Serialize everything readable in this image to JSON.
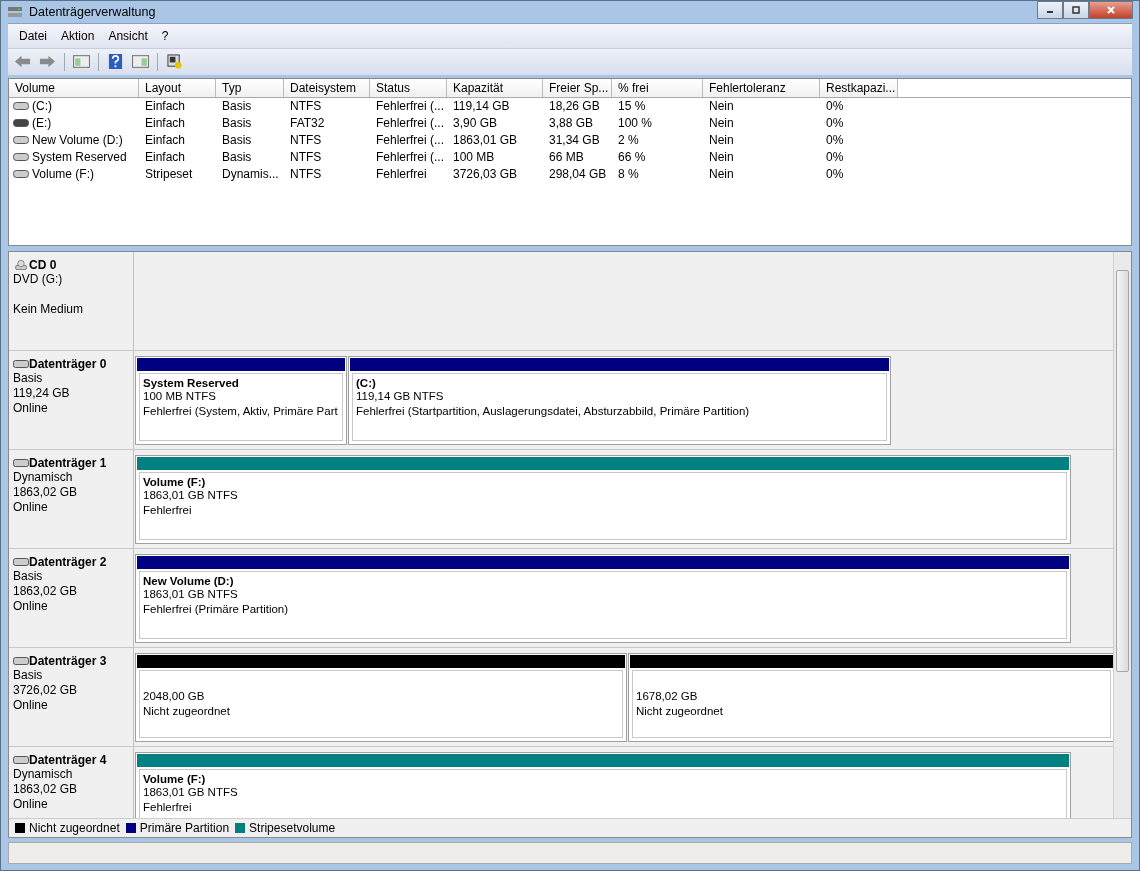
{
  "window": {
    "title": "Datenträgerverwaltung"
  },
  "menu": [
    "Datei",
    "Aktion",
    "Ansicht",
    "?"
  ],
  "table": {
    "columns": [
      "Volume",
      "Layout",
      "Typ",
      "Dateisystem",
      "Status",
      "Kapazität",
      "Freier Sp...",
      "% frei",
      "Fehlertoleranz",
      "Restkapazi..."
    ],
    "rows": [
      {
        "kind": "disk",
        "cells": [
          "(C:)",
          "Einfach",
          "Basis",
          "NTFS",
          "Fehlerfrei (...",
          "119,14 GB",
          "18,26 GB",
          "15 %",
          "Nein",
          "0%"
        ]
      },
      {
        "kind": "removable",
        "cells": [
          "(E:)",
          "Einfach",
          "Basis",
          "FAT32",
          "Fehlerfrei (...",
          "3,90 GB",
          "3,88 GB",
          "100 %",
          "Nein",
          "0%"
        ]
      },
      {
        "kind": "disk",
        "cells": [
          "New Volume (D:)",
          "Einfach",
          "Basis",
          "NTFS",
          "Fehlerfrei (...",
          "1863,01 GB",
          "31,34 GB",
          "2 %",
          "Nein",
          "0%"
        ]
      },
      {
        "kind": "disk",
        "cells": [
          "System Reserved",
          "Einfach",
          "Basis",
          "NTFS",
          "Fehlerfrei (...",
          "100 MB",
          "66 MB",
          "66 %",
          "Nein",
          "0%"
        ]
      },
      {
        "kind": "disk",
        "cells": [
          "Volume (F:)",
          "Stripeset",
          "Dynamis...",
          "NTFS",
          "Fehlerfrei",
          "3726,03 GB",
          "298,04 GB",
          "8 %",
          "Nein",
          "0%"
        ]
      }
    ]
  },
  "disks": [
    {
      "kind": "cd",
      "name": "CD 0",
      "lines": [
        "DVD (G:)",
        "Kein Medium"
      ]
    },
    {
      "kind": "disk",
      "name": "Datenträger 0",
      "lines": [
        "Basis",
        "119,24 GB",
        "Online"
      ],
      "partitions": [
        {
          "kind": "primary",
          "title": "System Reserved",
          "lines": [
            "100 MB NTFS",
            "Fehlerfrei (System, Aktiv, Primäre Part"
          ]
        },
        {
          "kind": "primary",
          "title": " (C:)",
          "lines": [
            "119,14 GB NTFS",
            "Fehlerfrei (Startpartition, Auslagerungsdatei, Absturzabbild, Primäre Partition)"
          ]
        }
      ]
    },
    {
      "kind": "disk",
      "name": "Datenträger 1",
      "lines": [
        "Dynamisch",
        "1863,02 GB",
        "Online"
      ],
      "partitions": [
        {
          "kind": "stripe",
          "title": "Volume  (F:)",
          "lines": [
            "1863,01 GB NTFS",
            "Fehlerfrei"
          ]
        }
      ]
    },
    {
      "kind": "disk",
      "name": "Datenträger 2",
      "lines": [
        "Basis",
        "1863,02 GB",
        "Online"
      ],
      "partitions": [
        {
          "kind": "primary",
          "title": "New Volume  (D:)",
          "lines": [
            "1863,01 GB NTFS",
            "Fehlerfrei (Primäre Partition)"
          ]
        }
      ]
    },
    {
      "kind": "disk",
      "name": "Datenträger 3",
      "lines": [
        "Basis",
        "3726,02 GB",
        "Online"
      ],
      "partitions": [
        {
          "kind": "unallocated",
          "lines": [
            "2048,00 GB",
            "Nicht zugeordnet"
          ]
        },
        {
          "kind": "unallocated",
          "lines": [
            "1678,02 GB",
            "Nicht zugeordnet"
          ]
        }
      ]
    },
    {
      "kind": "disk",
      "name": "Datenträger 4",
      "lines": [
        "Dynamisch",
        "1863,02 GB",
        "Online"
      ],
      "partitions": [
        {
          "kind": "stripe",
          "title": "Volume  (F:)",
          "lines": [
            "1863,01 GB NTFS",
            "Fehlerfrei"
          ]
        }
      ]
    }
  ],
  "legend": [
    {
      "label": "Nicht zugeordnet",
      "color": "#000000"
    },
    {
      "label": "Primäre Partition",
      "color": "#000080"
    },
    {
      "label": "Stripesetvolume",
      "color": "#008080"
    }
  ]
}
